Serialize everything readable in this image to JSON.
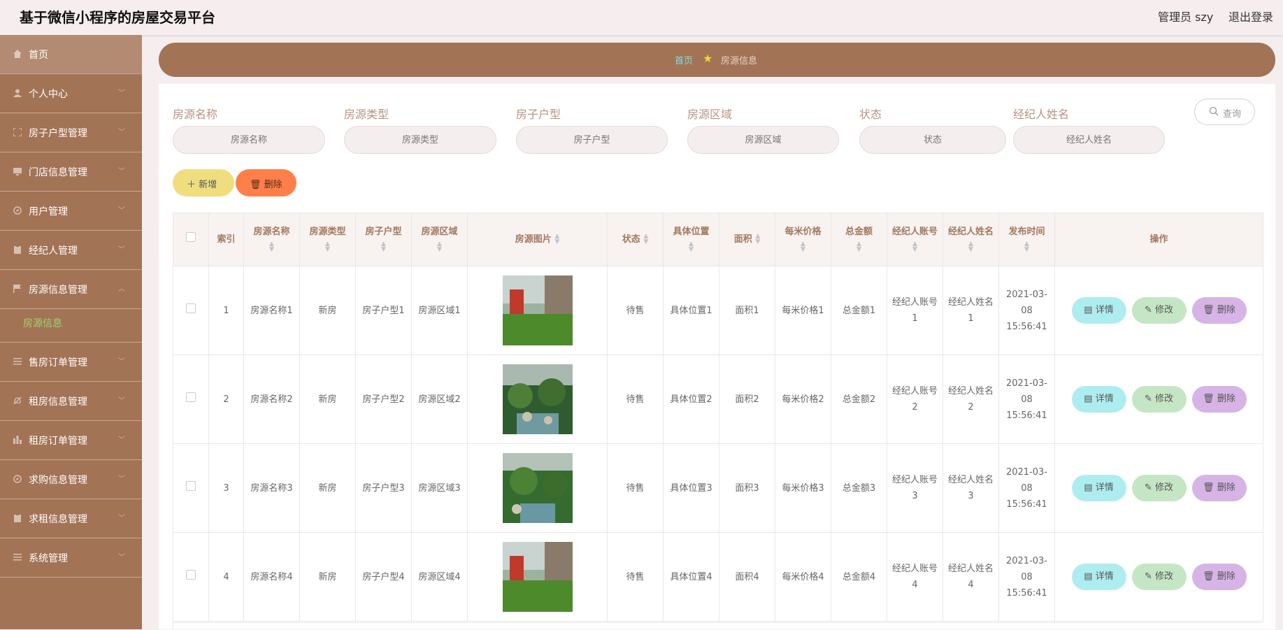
{
  "app": {
    "title": "基于微信小程序的房屋交易平台",
    "user": "管理员 szy",
    "logout": "退出登录"
  },
  "sidebar": {
    "items": [
      {
        "label": "首页",
        "icon": "home-icon",
        "active": true
      },
      {
        "label": "个人中心",
        "icon": "person-icon"
      },
      {
        "label": "房子户型管理",
        "icon": "frame-icon"
      },
      {
        "label": "门店信息管理",
        "icon": "monitor-icon"
      },
      {
        "label": "用户管理",
        "icon": "compass-icon"
      },
      {
        "label": "经纪人管理",
        "icon": "clipboard-icon"
      },
      {
        "label": "房源信息管理",
        "icon": "flag-icon",
        "expanded": true
      },
      {
        "label": "售房订单管理",
        "icon": "list-icon"
      },
      {
        "label": "租房信息管理",
        "icon": "bell-off-icon"
      },
      {
        "label": "租房订单管理",
        "icon": "bar-chart-icon"
      },
      {
        "label": "求购信息管理",
        "icon": "compass-icon"
      },
      {
        "label": "求租信息管理",
        "icon": "clipboard-icon"
      },
      {
        "label": "系统管理",
        "icon": "list-icon"
      }
    ],
    "sub_item": "房源信息"
  },
  "breadcrumb": {
    "home": "首页",
    "current": "房源信息"
  },
  "filters": [
    {
      "label": "房源名称",
      "placeholder": "房源名称"
    },
    {
      "label": "房源类型",
      "placeholder": "房源类型"
    },
    {
      "label": "房子户型",
      "placeholder": "房子户型"
    },
    {
      "label": "房源区域",
      "placeholder": "房源区域"
    },
    {
      "label": "状态",
      "placeholder": "状态"
    },
    {
      "label": "经纪人姓名",
      "placeholder": "经纪人姓名"
    }
  ],
  "buttons": {
    "search": "查询",
    "add": "新增",
    "delete": "删除"
  },
  "table": {
    "headers": [
      "索引",
      "房源名称",
      "房源类型",
      "房子户型",
      "房源区域",
      "房源图片",
      "状态",
      "具体位置",
      "面积",
      "每米价格",
      "总金额",
      "经纪人账号",
      "经纪人姓名",
      "发布时间",
      "操作"
    ],
    "rows": [
      [
        "1",
        "房源名称1",
        "新房",
        "房子户型1",
        "房源区域1",
        "",
        "待售",
        "具体位置1",
        "面积1",
        "每米价格1",
        "总金额1",
        "经纪人账号1",
        "经纪人姓名1",
        "2021-03-08 15:56:41"
      ],
      [
        "2",
        "房源名称2",
        "新房",
        "房子户型2",
        "房源区域2",
        "",
        "待售",
        "具体位置2",
        "面积2",
        "每米价格2",
        "总金额2",
        "经纪人账号2",
        "经纪人姓名2",
        "2021-03-08 15:56:41"
      ],
      [
        "3",
        "房源名称3",
        "新房",
        "房子户型3",
        "房源区域3",
        "",
        "待售",
        "具体位置3",
        "面积3",
        "每米价格3",
        "总金额3",
        "经纪人账号3",
        "经纪人姓名3",
        "2021-03-08 15:56:41"
      ],
      [
        "4",
        "房源名称4",
        "新房",
        "房子户型4",
        "房源区域4",
        "",
        "待售",
        "具体位置4",
        "面积4",
        "每米价格4",
        "总金额4",
        "经纪人账号4",
        "经纪人姓名4",
        "2021-03-08 15:56:41"
      ]
    ],
    "actions": {
      "detail": "详情",
      "edit": "修改",
      "remove": "删除"
    }
  }
}
